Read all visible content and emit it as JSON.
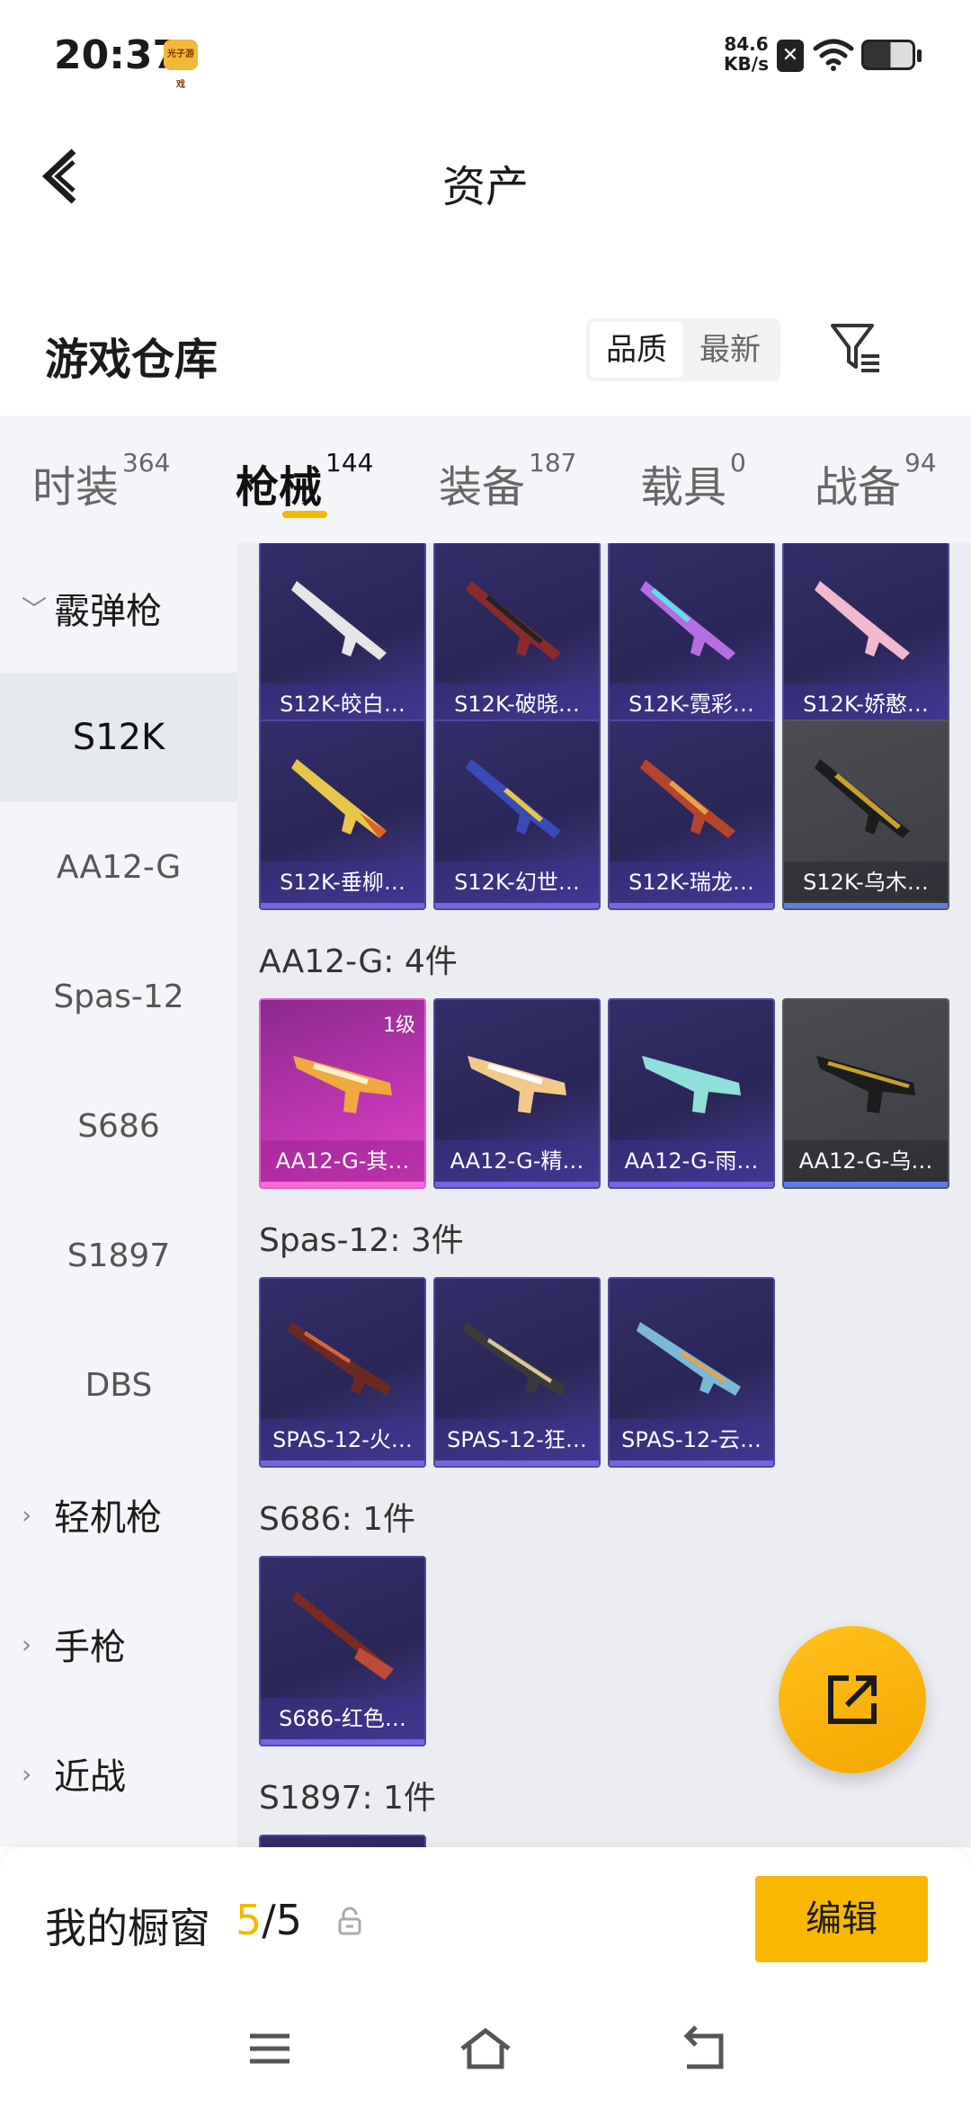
{
  "status_bar": {
    "time": "20:37",
    "app_icon_text": "光子游戏",
    "network_speed": "84.6\nKB/s",
    "speed_value": "84.6",
    "speed_unit": "KB/s"
  },
  "header": {
    "title": "资产"
  },
  "section": {
    "title": "游戏仓库",
    "sort_options": [
      "品质",
      "最新"
    ],
    "active_sort": "品质"
  },
  "tabs": [
    {
      "label": "时装",
      "count": "364"
    },
    {
      "label": "枪械",
      "count": "144"
    },
    {
      "label": "装备",
      "count": "187"
    },
    {
      "label": "载具",
      "count": "0"
    },
    {
      "label": "战备",
      "count": "94"
    }
  ],
  "sidebar": {
    "group_shotgun": "霰弹枪",
    "items": [
      "S12K",
      "AA12-G",
      "Spas-12",
      "S686",
      "S1897",
      "DBS"
    ],
    "group_lmg": "轻机枪",
    "group_pistol": "手枪",
    "group_melee": "近战"
  },
  "groups": {
    "aa12g_title": "AA12-G: 4件",
    "spas12_title": "Spas-12: 3件",
    "s686_title": "S686: 1件",
    "s1897_title": "S1897: 1件"
  },
  "cards": {
    "s12k": [
      "S12K-皎白…",
      "S12K-破晓…",
      "S12K-霓彩…",
      "S12K-娇憨…",
      "S12K-垂柳…",
      "S12K-幻世…",
      "S12K-瑞龙…",
      "S12K-乌木…"
    ],
    "aa12g": [
      "AA12-G-其…",
      "AA12-G-精…",
      "AA12-G-雨…",
      "AA12-G-乌…"
    ],
    "aa12g_level": "1级",
    "spas12": [
      "SPAS-12-火…",
      "SPAS-12-狂…",
      "SPAS-12-云…"
    ],
    "s686": [
      "S686-红色…"
    ]
  },
  "showcase": {
    "label": "我的橱窗",
    "current": "5",
    "total": "/5",
    "edit_label": "编辑"
  },
  "colors": {
    "accent": "#f8b800",
    "card_purple": "#2a2657",
    "card_gray": "#3d3e43",
    "card_pink": "#c136b2"
  }
}
